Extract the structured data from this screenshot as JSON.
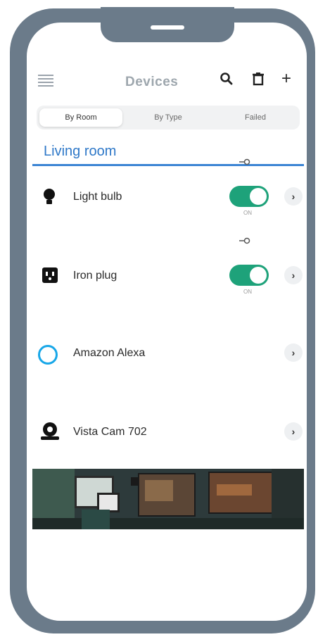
{
  "header": {
    "title": "Devices",
    "menu_icon": "menu-icon",
    "search_icon": "search-icon",
    "trash_icon": "trash-icon",
    "add_icon": "plus-icon"
  },
  "tabs": [
    {
      "label": "By Room",
      "active": true
    },
    {
      "label": "By Type",
      "active": false
    },
    {
      "label": "Failed",
      "active": false
    }
  ],
  "room": {
    "name": "Living room"
  },
  "devices": [
    {
      "name": "Light bulb",
      "icon": "lightbulb-icon",
      "has_toggle": true,
      "toggle_state": "ON"
    },
    {
      "name": "Iron plug",
      "icon": "plug-icon",
      "has_toggle": true,
      "toggle_state": "ON"
    },
    {
      "name": "Amazon Alexa",
      "icon": "alexa-icon",
      "has_toggle": false
    },
    {
      "name": "Vista Cam 702",
      "icon": "camera-icon",
      "has_toggle": false
    }
  ],
  "colors": {
    "frame": "#6b7b8a",
    "accent_blue": "#2e78c8",
    "toggle_green": "#1ea27a"
  }
}
